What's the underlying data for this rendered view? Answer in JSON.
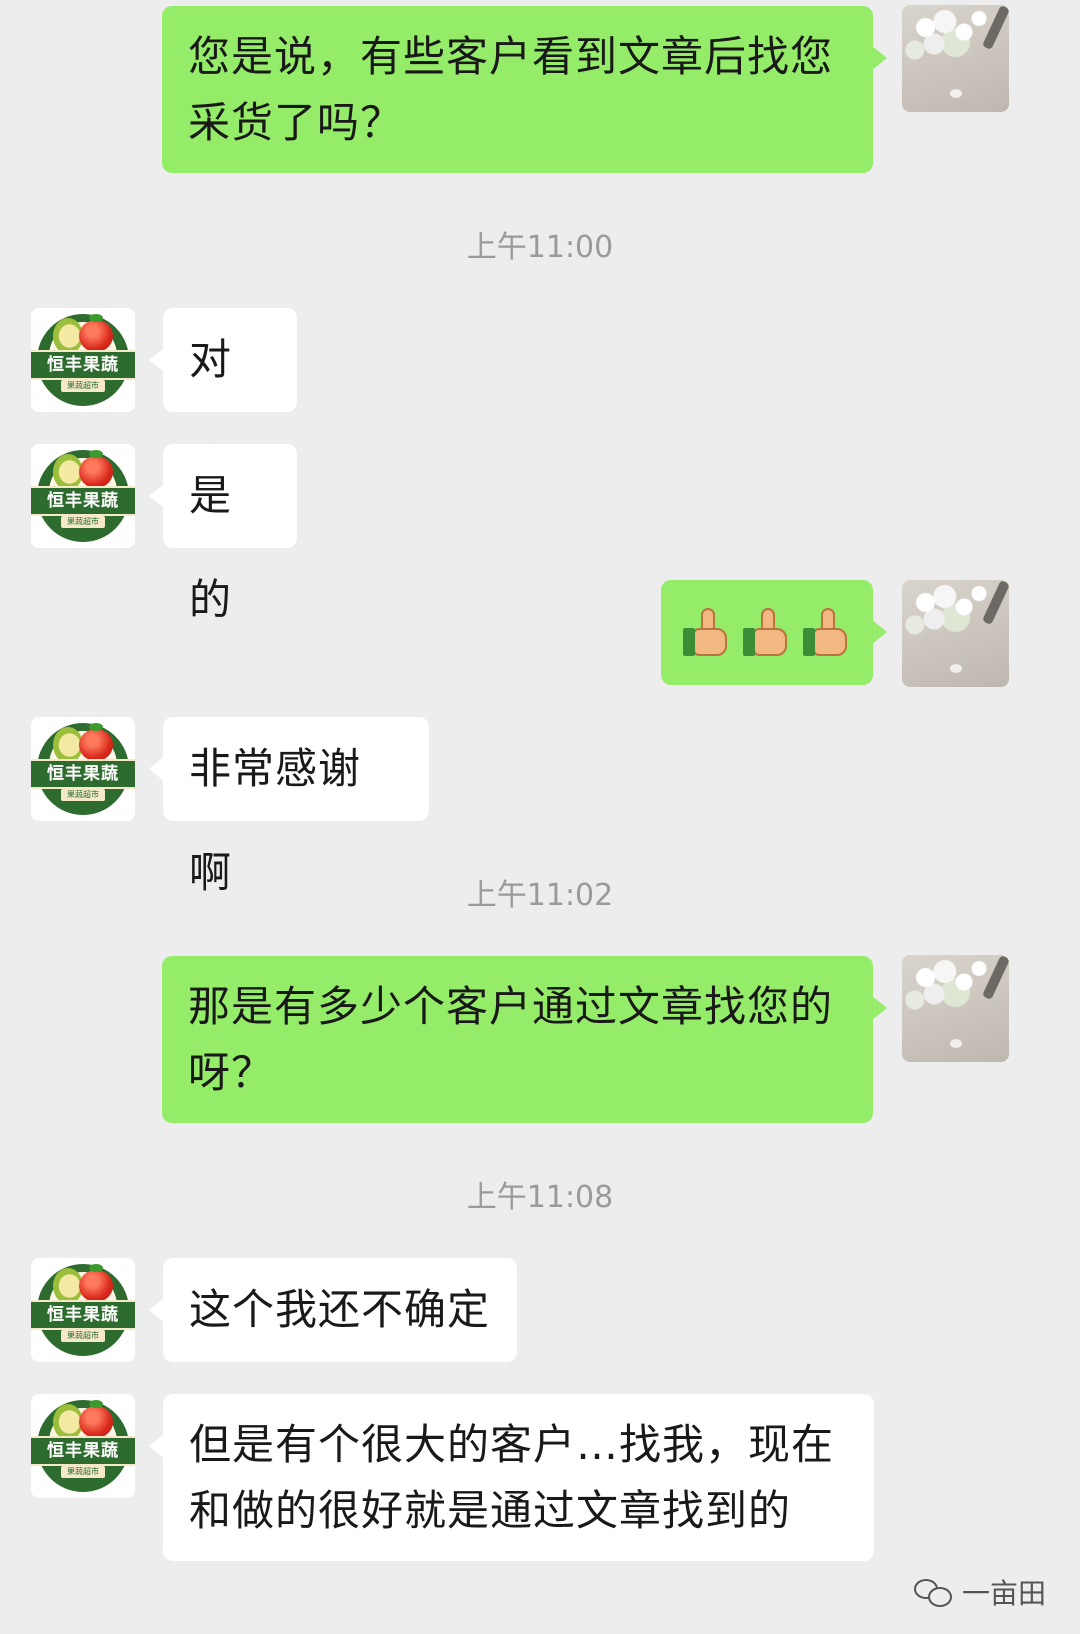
{
  "messages": [
    {
      "from": "me",
      "text": "您是说，有些客户看到文章后找您采货了吗？"
    },
    {
      "type": "time",
      "text": "上午11:00"
    },
    {
      "from": "other",
      "text": "对啊"
    },
    {
      "from": "other",
      "text": "是的"
    },
    {
      "from": "me",
      "emoji": "thumbs-up x3"
    },
    {
      "from": "other",
      "text": "非常感谢啊"
    },
    {
      "type": "time",
      "text": "上午11:02"
    },
    {
      "from": "me",
      "text": "那是有多少个客户通过文章找您的呀？"
    },
    {
      "type": "time",
      "text": "上午11:08"
    },
    {
      "from": "other",
      "text": "这个我还不确定"
    },
    {
      "from": "other",
      "text": "但是有个很大的客户…找我，现在和做的很好就是通过文章找到的"
    }
  ],
  "m1": {
    "line1": "您是说，有些客户看到文章后找您",
    "line2": "采货了吗？"
  },
  "t1": "上午11:00",
  "m2": "对啊",
  "m3": "是的",
  "m5": "非常感谢啊",
  "t2": "上午11:02",
  "m6": {
    "line1": "那是有多少个客户通过文章找您的",
    "line2": "呀？"
  },
  "t3": "上午11:08",
  "m7": "这个我还不确定",
  "m8": {
    "line1": "但是有个很大的客户…找我，现在",
    "line2": "和做的很好就是通过文章找到的"
  },
  "avatar_other": {
    "brand": "恒丰果蔬",
    "sub": "果蔬超市"
  },
  "watermark": "一亩田",
  "colors": {
    "background": "#ededed",
    "my_bubble": "#95ec69",
    "other_bubble": "#ffffff",
    "timestamp": "#9a9a9a"
  }
}
